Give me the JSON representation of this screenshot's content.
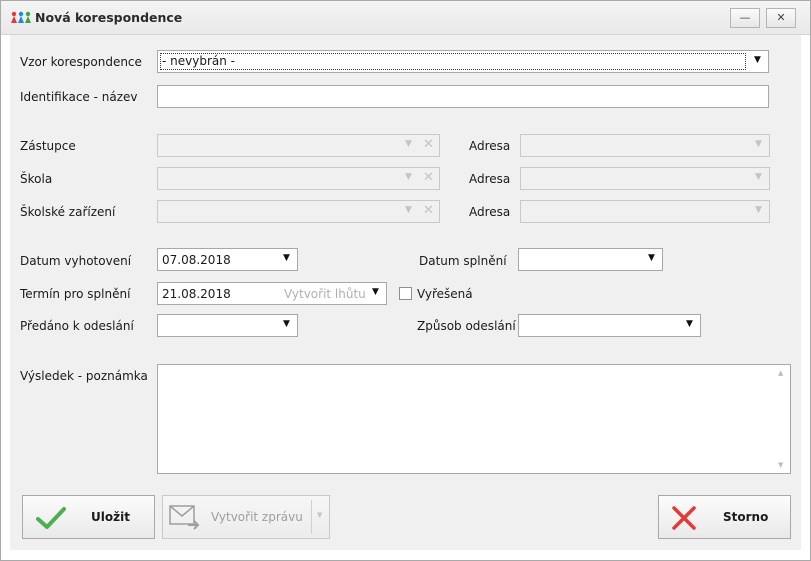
{
  "window": {
    "title": "Nová korespondence",
    "minimize_symbol": "—",
    "close_symbol": "✕"
  },
  "form": {
    "vzor_label": "Vzor korespondence",
    "vzor_value": "- nevybrán -",
    "identifikace_label": "Identifikace - název",
    "identifikace_value": "",
    "zastupce_label": "Zástupce",
    "skola_label": "Škola",
    "skolske_label": "Školské zařízení",
    "adresa_label": "Adresa",
    "datum_vyhotoveni_label": "Datum vyhotovení",
    "datum_vyhotoveni_value": "07.08.2018",
    "termin_label": "Termín pro splnění",
    "termin_value": "21.08.2018",
    "termin_hint": "Vytvořit lhůtu",
    "predano_label": "Předáno k odeslání",
    "predano_value": "",
    "datum_splneni_label": "Datum splnění",
    "datum_splneni_value": "",
    "vyresena_label": "Vyřešená",
    "vyresena_checked": false,
    "zpusob_label": "Způsob odeslání",
    "zpusob_value": "",
    "vysledek_label": "Výsledek - poznámka",
    "vysledek_value": ""
  },
  "buttons": {
    "save_label": "Uložit",
    "create_message_label": "Vytvořit zprávu",
    "cancel_label": "Storno"
  },
  "icons": {
    "app": "people-icon",
    "save": "checkmark-icon",
    "message": "envelope-arrow-icon",
    "cancel": "x-icon",
    "dropdown": "dropdown-arrow-icon",
    "clear": "clear-x-icon"
  },
  "colors": {
    "check_green": "#4caf50",
    "cancel_red": "#e53935",
    "panel_bg": "#f0f0f0"
  }
}
